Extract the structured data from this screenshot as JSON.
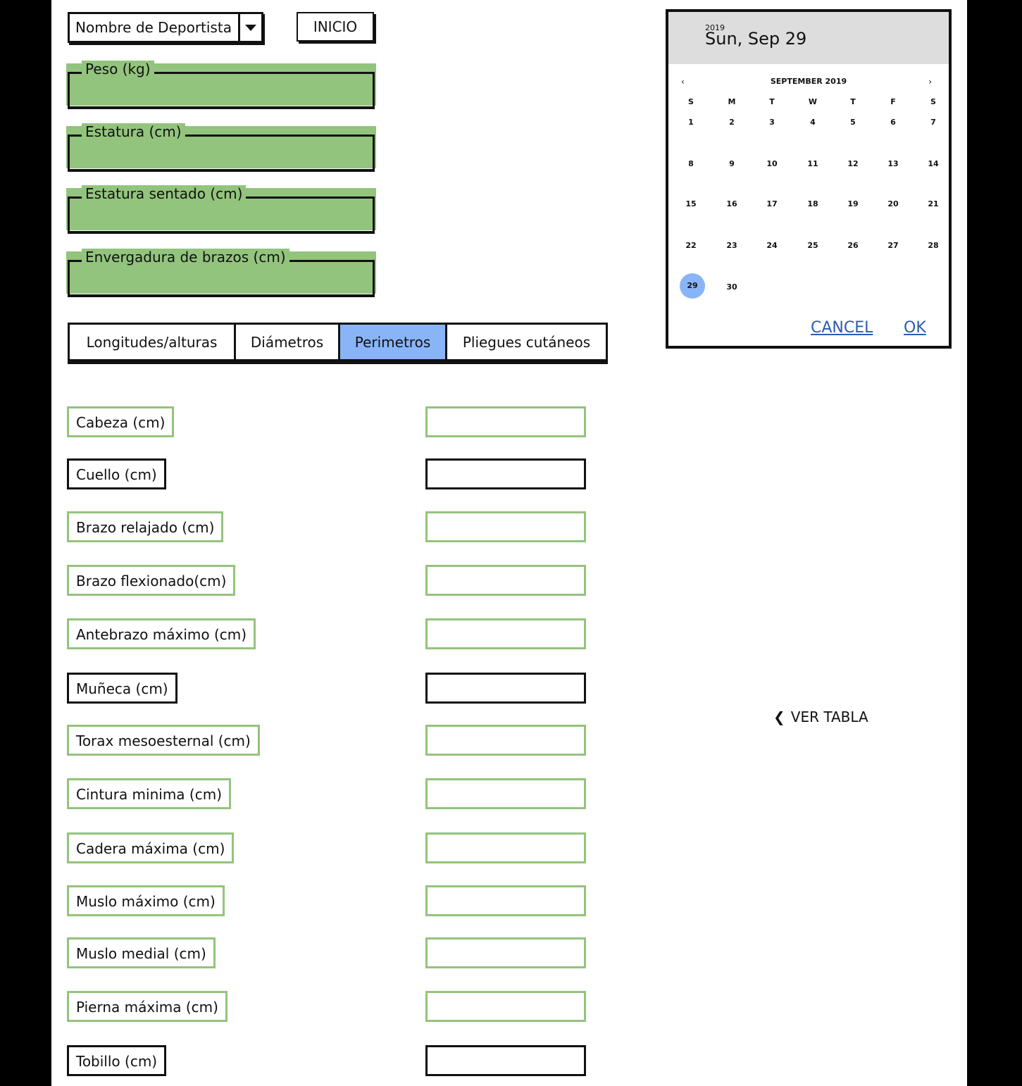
{
  "top": {
    "athlete_select": "Nombre de Deportista",
    "start_button": "INICIO"
  },
  "fields": [
    {
      "label": "Peso (kg)"
    },
    {
      "label": "Estatura (cm)"
    },
    {
      "label": "Estatura sentado (cm)"
    },
    {
      "label": "Envergadura de brazos (cm)"
    }
  ],
  "tabs": [
    {
      "label": "Longitudes/alturas",
      "active": false
    },
    {
      "label": "Diámetros",
      "active": false
    },
    {
      "label": "Perimetros",
      "active": true
    },
    {
      "label": "Pliegues cutáneos",
      "active": false
    }
  ],
  "measures": [
    {
      "label": "Cabeza (cm)",
      "value": ""
    },
    {
      "label": "Cuello (cm)",
      "value": ""
    },
    {
      "label": "Brazo relajado (cm)",
      "value": ""
    },
    {
      "label": "Brazo flexionado(cm)",
      "value": ""
    },
    {
      "label": "Antebrazo máximo (cm)",
      "value": ""
    },
    {
      "label": "Muñeca (cm)",
      "value": ""
    },
    {
      "label": "Torax mesoesternal (cm)",
      "value": ""
    },
    {
      "label": "Cintura minima (cm)",
      "value": ""
    },
    {
      "label": "Cadera máxima (cm)",
      "value": ""
    },
    {
      "label": "Muslo máximo (cm)",
      "value": ""
    },
    {
      "label": "Muslo medial (cm)",
      "value": ""
    },
    {
      "label": "Pierna máxima (cm)",
      "value": ""
    },
    {
      "label": "Tobillo (cm)",
      "value": ""
    }
  ],
  "datepicker": {
    "year": "2019",
    "selected_label": "Sun, Sep 29",
    "month_label": "SEPTEMBER 2019",
    "prev": "‹",
    "next": "›",
    "weekdays": [
      "S",
      "M",
      "T",
      "W",
      "T",
      "F",
      "S"
    ],
    "weeks": [
      [
        "1",
        "2",
        "3",
        "4",
        "5",
        "6",
        "7"
      ],
      [
        "8",
        "9",
        "10",
        "11",
        "12",
        "13",
        "14"
      ],
      [
        "15",
        "16",
        "17",
        "18",
        "19",
        "20",
        "21"
      ],
      [
        "22",
        "23",
        "24",
        "25",
        "26",
        "27",
        "28"
      ],
      [
        "29",
        "30"
      ]
    ],
    "selected_day": "29",
    "cancel": "CANCEL",
    "ok": "OK"
  },
  "ver_tabla": {
    "icon": "chevron-left-icon",
    "label": "VER TABLA"
  },
  "colors": {
    "green": "#93c47d",
    "active_tab": "#8ab4f8",
    "link": "#2a5db0"
  }
}
